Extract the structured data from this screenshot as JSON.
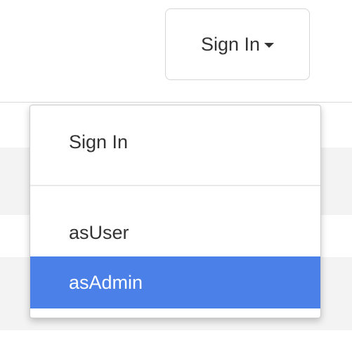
{
  "header": {
    "signin_button_label": "Sign In",
    "caret_icon": "caret-down-icon"
  },
  "dropdown": {
    "items": [
      {
        "label": "Sign In"
      },
      {
        "label": "asUser"
      },
      {
        "label": "asAdmin",
        "active": true
      }
    ],
    "active_color": "#4a80e8"
  }
}
